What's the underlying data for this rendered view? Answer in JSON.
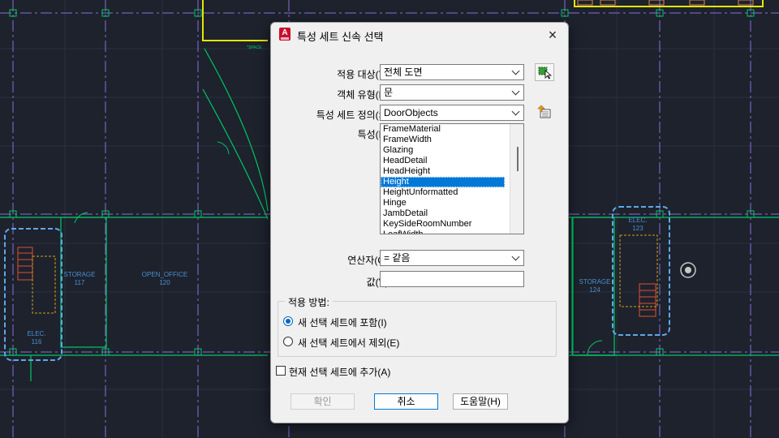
{
  "drawing": {
    "rooms": [
      {
        "name": "STORAGE",
        "number": "117"
      },
      {
        "name": "OPEN_OFFICE",
        "number": "120"
      },
      {
        "name": "ELEC.",
        "number": "116"
      },
      {
        "name": "STORAGE",
        "number": "124"
      },
      {
        "name": "ELEC.",
        "number": "123"
      }
    ],
    "space_tag": "*SPACE"
  },
  "dialog": {
    "title": "특성 세트 신속 선택",
    "close_glyph": "×",
    "apply_to_label": "적용 대상(Y):",
    "apply_to_value": "전체 도면",
    "object_type_label": "객체 유형(B):",
    "object_type_value": "문",
    "property_set_label": "특성 세트 정의(S):",
    "property_set_value": "DoorObjects",
    "properties_label": "특성(P):",
    "properties": [
      "FrameMaterial",
      "FrameWidth",
      "Glazing",
      "HeadDetail",
      "HeadHeight",
      "Height",
      "HeightUnformatted",
      "Hinge",
      "JambDetail",
      "KeySideRoomNumber",
      "LeafWidth"
    ],
    "selected_property": "Height",
    "operator_label": "연산자(O):",
    "operator_value": "= 같음",
    "value_label": "값(V):",
    "value_value": "",
    "how_to_apply_label": "적용 방법:",
    "include_label": "새 선택 세트에 포함(I)",
    "exclude_label": "새 선택 세트에서 제외(E)",
    "include_selected": true,
    "append_label": "현재 선택 세트에 추가(A)",
    "append_checked": false,
    "ok_label": "확인",
    "cancel_label": "취소",
    "help_label": "도움말(H)"
  },
  "colors": {
    "background": "#1d222d",
    "wall": "#00c864",
    "grid_line": "#8c6fd6",
    "highlight": "#e6e600",
    "selection": "#5fa8e8",
    "accent": "#0078d7"
  }
}
